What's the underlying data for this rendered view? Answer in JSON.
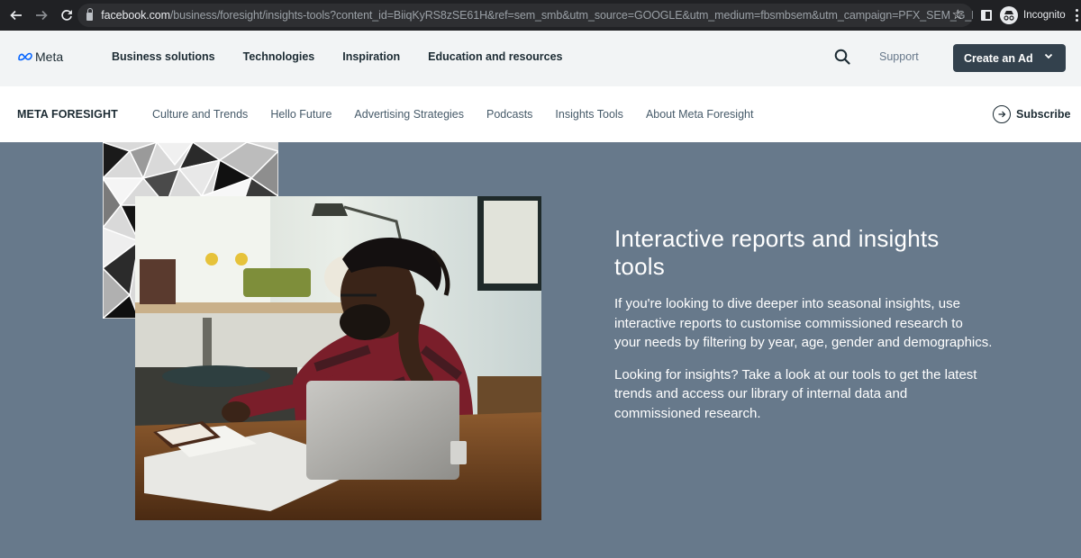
{
  "browser": {
    "url_host": "facebook.com",
    "url_path": "/business/foresight/insights-tools?content_id=BiiqKyRS8zSE61H&ref=sem_smb&utm_source=GOOGLE&utm_medium=fbsmbsem&utm_campaign=PFX_SEM_G_BusinessAds_R...",
    "profile_label": "Incognito",
    "icons": {
      "back": "arrow-left",
      "forward": "arrow-right",
      "reload": "reload",
      "bookmark": "star",
      "side_panel": "side-panel",
      "menu": "kebab"
    }
  },
  "header": {
    "logo_text": "Meta",
    "nav": [
      {
        "label": "Business solutions"
      },
      {
        "label": "Technologies"
      },
      {
        "label": "Inspiration"
      },
      {
        "label": "Education and resources"
      }
    ],
    "support_label": "Support",
    "create_ad_label": "Create an Ad",
    "brand_color": "#0866ff",
    "button_color": "#33414d"
  },
  "subnav": {
    "brand": "META FORESIGHT",
    "items": [
      {
        "label": "Culture and Trends"
      },
      {
        "label": "Hello Future"
      },
      {
        "label": "Advertising Strategies"
      },
      {
        "label": "Podcasts"
      },
      {
        "label": "Insights Tools"
      },
      {
        "label": "About Meta Foresight"
      }
    ],
    "subscribe_label": "Subscribe"
  },
  "hero": {
    "background_color": "#67798b",
    "title": "Interactive reports and insights tools",
    "paragraphs": [
      "If you're looking to dive deeper into seasonal insights, use interactive reports to customise commissioned research to your needs by filtering by year, age, gender and demographics.",
      "Looking for insights? Take a look at our tools to get the latest trends and access our library of internal data and commissioned research."
    ],
    "images": {
      "pattern_alt": "Black, white and grey geometric triangle pattern",
      "photo_alt": "Man with glasses writing in a notebook beside a laptop at a wooden table"
    }
  }
}
